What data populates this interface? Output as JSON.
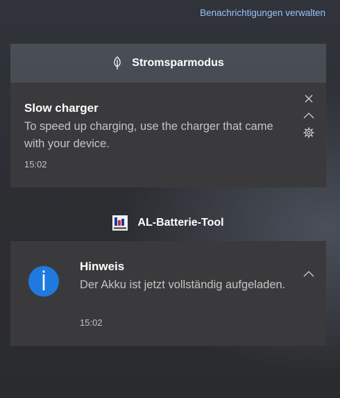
{
  "header": {
    "manage_link": "Benachrichtigungen verwalten"
  },
  "groups": [
    {
      "title": "Stromsparmodus",
      "icon": "leaf-icon",
      "notification": {
        "title": "Slow charger",
        "body": "To speed up charging, use the charger that came with your device.",
        "time": "15:02",
        "controls": [
          "close-icon",
          "chevron-up-icon",
          "gear-icon"
        ]
      }
    },
    {
      "title": "AL-Batterie-Tool",
      "icon": "battery-tool-app-icon",
      "notification": {
        "title": "Hinweis",
        "body": "Der Akku ist jetzt vollständig aufgeladen.",
        "time": "15:02",
        "icon": "info-icon",
        "controls": [
          "chevron-up-icon"
        ]
      }
    }
  ],
  "colors": {
    "link": "#99c3ff",
    "card_bg": "#3a3a3c",
    "info_icon": "#1f7ae0"
  }
}
